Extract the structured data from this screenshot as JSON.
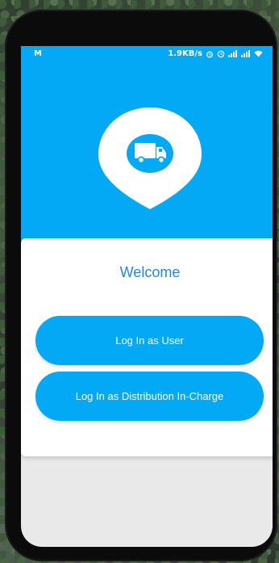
{
  "status_bar": {
    "carrier_glyph": "M",
    "network_speed": "1.9KB/s"
  },
  "welcome": {
    "title": "Welcome"
  },
  "actions": {
    "login_user": "Log In as User",
    "login_distribution": "Log In as Distribution In-Charge"
  },
  "colors": {
    "primary": "#03a9f4",
    "title": "#1e88e5",
    "card": "#ffffff",
    "screen_bg": "#e9e9e9"
  },
  "icons": [
    "location-pin-icon",
    "truck-icon",
    "alarm-icon",
    "clock-icon",
    "signal-icon",
    "wifi-icon"
  ]
}
